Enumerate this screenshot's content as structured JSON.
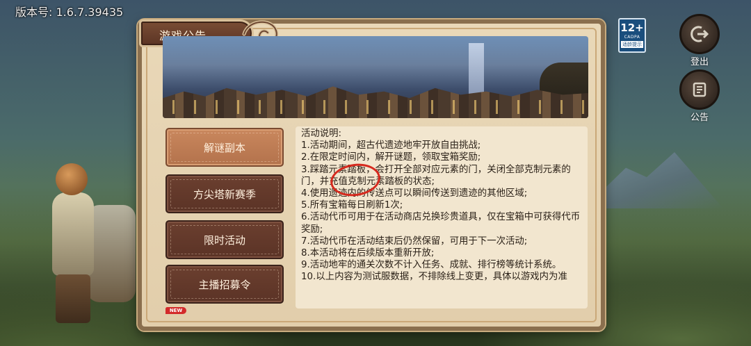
{
  "version_label": "版本号: 1.6.7.39435",
  "age_rating": {
    "age": "12+",
    "org": "CADPA",
    "tip": "适龄提示"
  },
  "side_buttons": {
    "logout": "登出",
    "notice": "公告"
  },
  "panel": {
    "title": "游戏公告"
  },
  "menu": {
    "items": [
      {
        "label": "解谜副本",
        "active": true
      },
      {
        "label": "方尖塔新赛季",
        "active": false
      },
      {
        "label": "限时活动",
        "active": false
      },
      {
        "label": "主播招募令",
        "active": false
      }
    ],
    "new_badge": "NEW"
  },
  "content": {
    "lines": [
      "活动说明:",
      "1.活动期间，超古代遗迹地牢开放自由挑战;",
      "2.在限定时间内，解开谜题，领取宝箱奖励;",
      "3.踩踏元素踏板，会打开全部对应元素的门，关闭全部克制元素的门，并充值克制元素踏板的状态;",
      "4.使用遗迹内的传送点可以瞬间传送到遗迹的其他区域;",
      "5.所有宝箱每日刷新1次;",
      "6.活动代币可用于在活动商店兑换珍贵道具，仅在宝箱中可获得代币奖励;",
      "7.活动代币在活动结束后仍然保留，可用于下一次活动;",
      "8.本活动将在后续版本重新开放;",
      "9.活动地牢的通关次数不计入任务、成就、排行榜等统计系统。",
      "10.以上内容为测试服数据，不排除线上变更，具体以游戏内为准"
    ]
  }
}
